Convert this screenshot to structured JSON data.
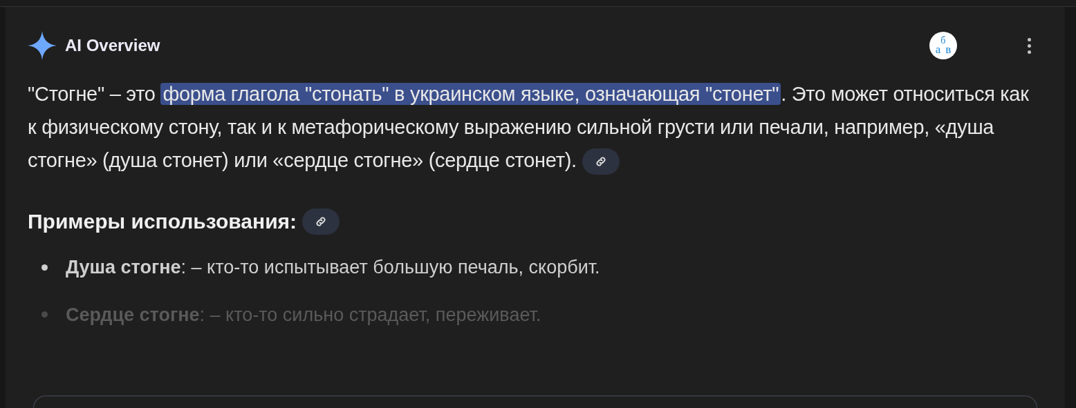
{
  "header": {
    "title": "AI Overview",
    "translate_badge": {
      "a": "а",
      "b": "б",
      "c": "в"
    }
  },
  "answer": {
    "before": "\"Стогне\" – это ",
    "highlight": "форма глагола \"стонать\" в украинском языке, означающая \"стонет\"",
    "after": ". Это может относиться как к физическому стону, так и к метафорическому выражению сильной грусти или печали, например, «душа стогне» (душа стонет) или «сердце стогне» (сердце стонет)."
  },
  "section": {
    "heading": "Примеры использования:"
  },
  "examples": [
    {
      "text": "**Душа стогне**: – кто-то испытывает большую печаль, скорбит.",
      "faded": false
    },
    {
      "text": "**Сердце стогне**: – кто-то сильно страдает, переживает.",
      "faded": true
    }
  ]
}
